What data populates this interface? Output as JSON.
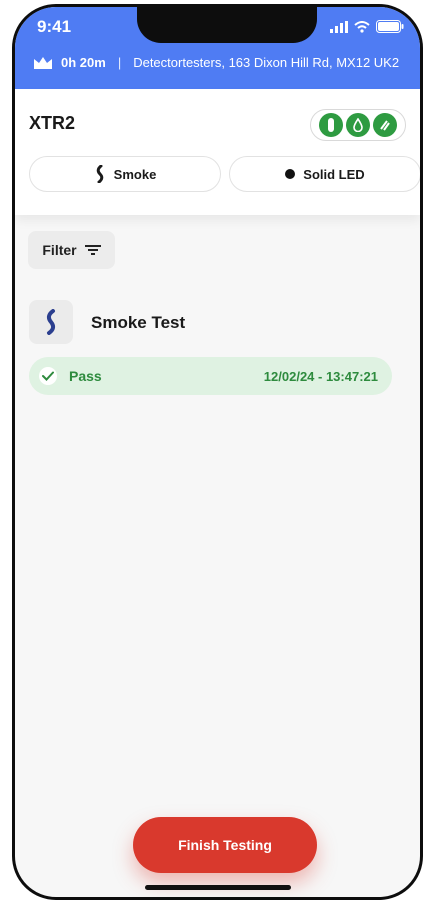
{
  "status": {
    "time": "9:41"
  },
  "info_bar": {
    "duration": "0h 20m",
    "address": "Detectortesters, 163 Dixon Hill Rd, MX12 UK2"
  },
  "device": {
    "name": "XTR2"
  },
  "chips": [
    {
      "label": "Smoke",
      "icon": "smoke-icon"
    },
    {
      "label": "Solid LED",
      "icon": "dot-icon"
    }
  ],
  "filter": {
    "label": "Filter"
  },
  "test": {
    "title": "Smoke Test",
    "result": "Pass",
    "timestamp": "12/02/24 - 13:47:21"
  },
  "footer": {
    "finish_label": "Finish Testing"
  },
  "colors": {
    "accent_blue": "#4f7cf3",
    "pass_green": "#2e8b3e",
    "finish_red": "#d9392d",
    "icon_navy": "#2b3f8f"
  }
}
